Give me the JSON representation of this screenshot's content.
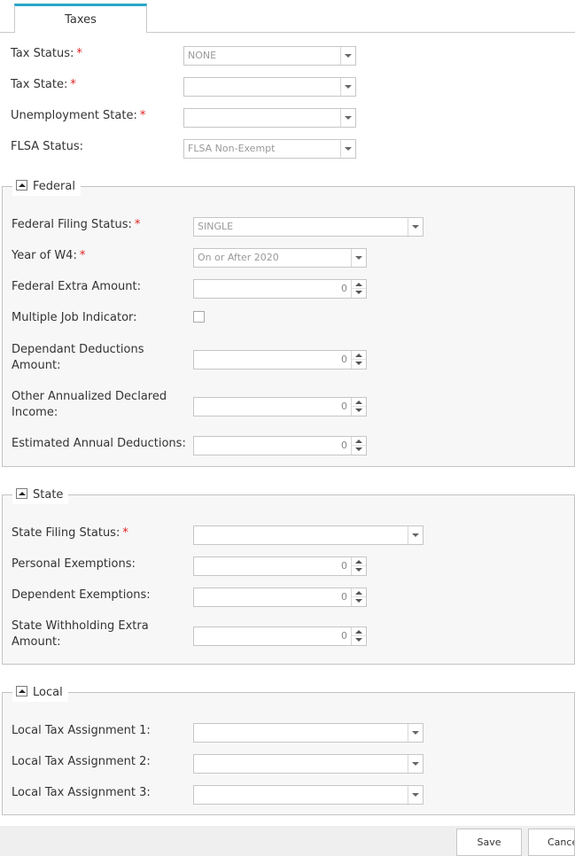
{
  "tab": {
    "label": "Taxes"
  },
  "general": {
    "tax_status": {
      "label": "Tax Status:",
      "required": "*",
      "value": "NONE"
    },
    "tax_state": {
      "label": "Tax State:",
      "required": "*",
      "value": ""
    },
    "unemployment_state": {
      "label": "Unemployment State:",
      "required": "*",
      "value": ""
    },
    "flsa_status": {
      "label": "FLSA Status:",
      "value": "FLSA Non-Exempt"
    }
  },
  "federal": {
    "legend": "Federal",
    "filing_status": {
      "label": "Federal Filing Status:",
      "required": "*",
      "value": "SINGLE"
    },
    "year_w4": {
      "label": "Year of W4:",
      "required": "*",
      "value": "On or After 2020"
    },
    "extra_amount": {
      "label": "Federal Extra Amount:",
      "value": "0"
    },
    "multiple_job": {
      "label": "Multiple Job Indicator:",
      "checked": false
    },
    "dependant_deductions": {
      "label": "Dependant Deductions Amount:",
      "value": "0"
    },
    "other_income": {
      "label": "Other Annualized Declared Income:",
      "value": "0"
    },
    "estimated_deductions": {
      "label": "Estimated Annual Deductions:",
      "value": "0"
    }
  },
  "state": {
    "legend": "State",
    "filing_status": {
      "label": "State Filing Status:",
      "required": "*",
      "value": ""
    },
    "personal_exemptions": {
      "label": "Personal Exemptions:",
      "value": "0"
    },
    "dependent_exemptions": {
      "label": "Dependent Exemptions:",
      "value": "0"
    },
    "withholding_extra": {
      "label": "State Withholding Extra Amount:",
      "value": "0"
    }
  },
  "local": {
    "legend": "Local",
    "assignment_1": {
      "label": "Local Tax Assignment 1:",
      "value": ""
    },
    "assignment_2": {
      "label": "Local Tax Assignment 2:",
      "value": ""
    },
    "assignment_3": {
      "label": "Local Tax Assignment 3:",
      "value": ""
    }
  },
  "footer": {
    "save_label": "Save",
    "cancel_label": "Cancel"
  }
}
